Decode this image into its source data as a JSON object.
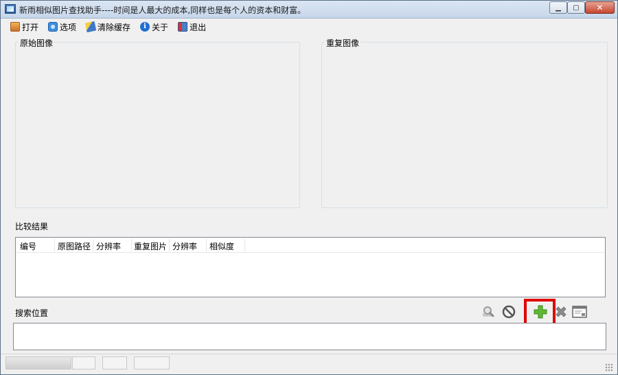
{
  "window": {
    "title": "新雨相似图片查找助手----时间是人最大的成本,同样也是每个人的资本和财富。",
    "controls": {
      "minimize": "▁",
      "maximize": "▢",
      "close": "✕"
    }
  },
  "menu": [
    {
      "label": "打开",
      "icon": "open-folder-icon"
    },
    {
      "label": "选项",
      "icon": "options-icon"
    },
    {
      "label": "清除缓存",
      "icon": "broom-icon"
    },
    {
      "label": "关于",
      "icon": "info-icon"
    },
    {
      "label": "退出",
      "icon": "exit-door-icon"
    }
  ],
  "panels": {
    "original": "原始图像",
    "duplicate": "重复图像"
  },
  "results": {
    "label": "比较结果",
    "columns": [
      "编号",
      "原图路径",
      "分辨率",
      "重复图片",
      "分辨率",
      "相似度"
    ],
    "rows": []
  },
  "search": {
    "label": "搜索位置",
    "value": "",
    "toolbar": [
      {
        "icon": "search-magnifier-icon",
        "enabled": false
      },
      {
        "icon": "stop-icon",
        "enabled": true
      },
      {
        "icon": "add-plus-icon",
        "enabled": true,
        "highlighted": true
      },
      {
        "icon": "remove-x-icon",
        "enabled": true
      },
      {
        "icon": "window-icon",
        "enabled": true
      }
    ]
  },
  "colors": {
    "highlight": "#e00000",
    "add_green": "#5fb832",
    "window_bg": "#f0f0f0"
  }
}
